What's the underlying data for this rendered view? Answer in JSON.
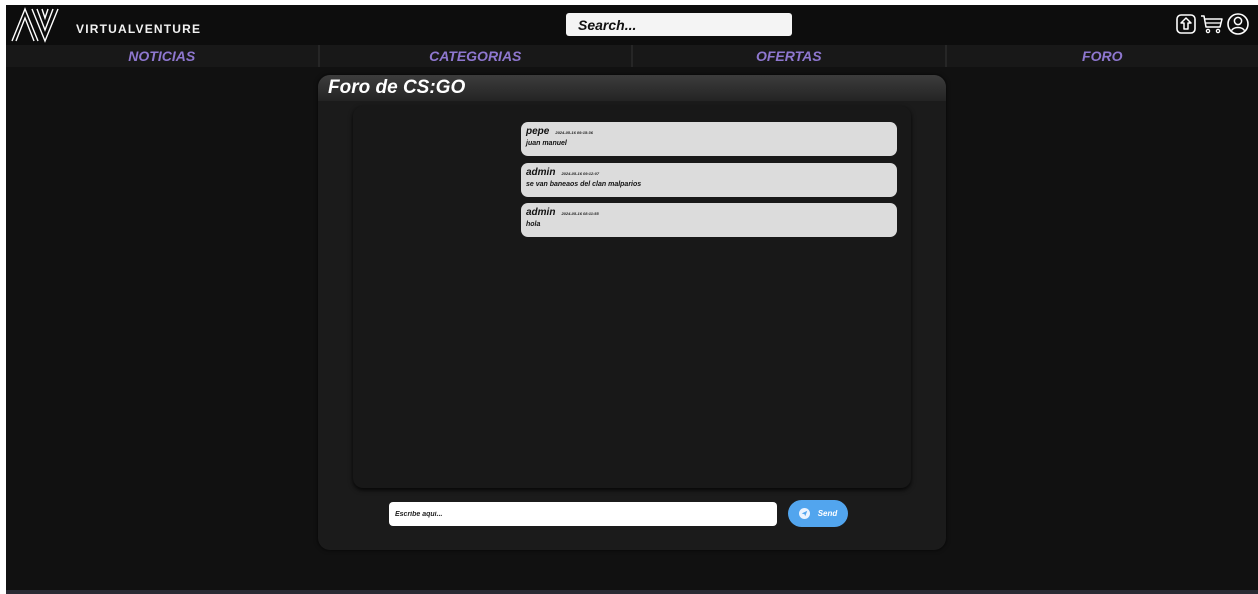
{
  "header": {
    "brand": "VIRTUALVENTURE",
    "logo_icon": "av-logo-icon",
    "search_placeholder": "Search...",
    "icons": [
      "upload-icon",
      "cart-icon",
      "user-icon"
    ]
  },
  "nav": {
    "items": [
      {
        "label": "NOTICIAS"
      },
      {
        "label": "CATEGORIAS"
      },
      {
        "label": "OFERTAS"
      },
      {
        "label": "FORO"
      }
    ]
  },
  "forum": {
    "title": "Foro de CS:GO",
    "messages": [
      {
        "user": "pepe",
        "time": "2024-05-16 09:15:36",
        "text": "juan manuel"
      },
      {
        "user": "admin",
        "time": "2024-05-16 09:12:07",
        "text": "se van baneaos del clan malparios"
      },
      {
        "user": "admin",
        "time": "2024-05-16 08:11:55",
        "text": "hola"
      }
    ],
    "input_placeholder": "Escribe aqui...",
    "send_label": "Send"
  },
  "colors": {
    "background": "#111111",
    "nav_text": "#8e77cf",
    "send_button": "#52a5ee",
    "message_bubble": "#dcdcdc"
  }
}
